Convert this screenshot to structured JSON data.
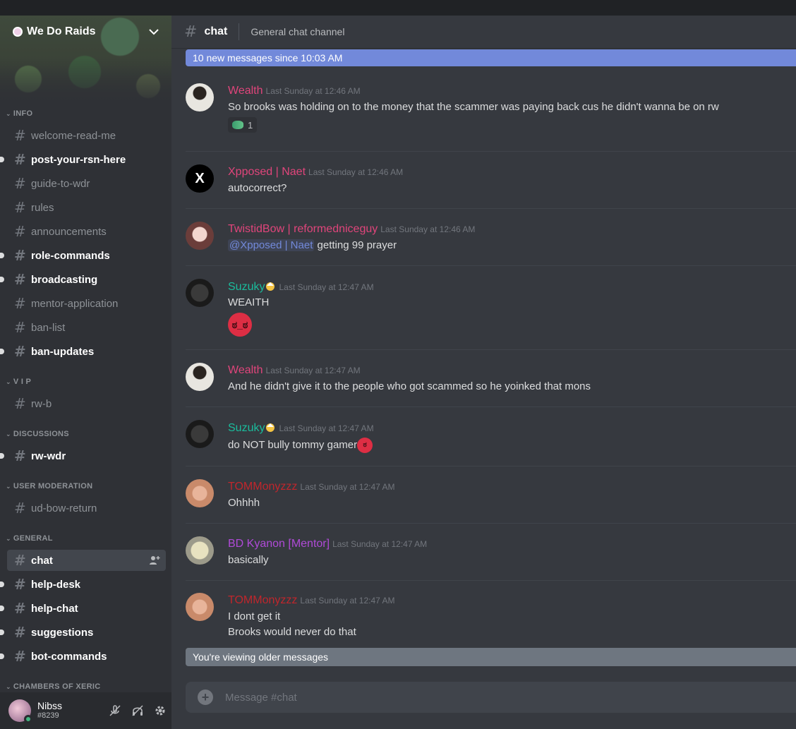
{
  "guild": {
    "name": "We Do Raids",
    "dropdown_icon": "chevron-down-icon"
  },
  "categories": [
    {
      "label": "INFO"
    },
    {
      "label": "V I P"
    },
    {
      "label": "DISCUSSIONS"
    },
    {
      "label": "USER MODERATION"
    },
    {
      "label": "GENERAL"
    },
    {
      "label": "CHAMBERS OF XERIC"
    }
  ],
  "channels": [
    {
      "label": "welcome-read-me"
    },
    {
      "label": "post-your-rsn-here"
    },
    {
      "label": "guide-to-wdr"
    },
    {
      "label": "rules"
    },
    {
      "label": "announcements"
    },
    {
      "label": "role-commands"
    },
    {
      "label": "broadcasting"
    },
    {
      "label": "mentor-application"
    },
    {
      "label": "ban-list"
    },
    {
      "label": "ban-updates"
    },
    {
      "label": "rw-b"
    },
    {
      "label": "rw-wdr"
    },
    {
      "label": "ud-bow-return"
    },
    {
      "label": "chat"
    },
    {
      "label": "help-desk"
    },
    {
      "label": "help-chat"
    },
    {
      "label": "suggestions"
    },
    {
      "label": "bot-commands"
    }
  ],
  "user": {
    "name": "Nibss",
    "tag": "#8239"
  },
  "header": {
    "channel": "chat",
    "topic": "General chat channel"
  },
  "new_messages_bar": "10 new messages since 10:03 AM",
  "older_messages_bar": "You're viewing older messages",
  "composer": {
    "placeholder": "Message #chat"
  },
  "messages": [
    {
      "author": "Wealth",
      "timestamp": "Last Sunday at 12:46 AM",
      "lines": [
        "So brooks was holding on to the money that the scammer was paying back cus he didn't wanna be on rw"
      ],
      "reaction_count": "1"
    },
    {
      "author": "Xpposed | Naet",
      "timestamp": "Last Sunday at 12:46 AM",
      "lines": [
        "autocorrect?"
      ]
    },
    {
      "author": "TwistidBow | reformedniceguy",
      "timestamp": "Last Sunday at 12:46 AM",
      "mention": "@Xpposed | Naet",
      "lines": [
        "getting 99 prayer"
      ]
    },
    {
      "author": "Suzuky",
      "timestamp": "Last Sunday at 12:47 AM",
      "lines": [
        "WEAITH"
      ]
    },
    {
      "author": "Wealth",
      "timestamp": "Last Sunday at 12:47 AM",
      "lines": [
        "And he didn't give it to the people who got scammed so he yoinked that mons"
      ]
    },
    {
      "author": "Suzuky",
      "timestamp": "Last Sunday at 12:47 AM",
      "lines": [
        "do NOT bully tommy gamer"
      ]
    },
    {
      "author": "TOMMonyzzz",
      "timestamp": "Last Sunday at 12:47 AM",
      "lines": [
        "Ohhhh"
      ]
    },
    {
      "author": "BD Kyanon [Mentor]",
      "timestamp": "Last Sunday at 12:47 AM",
      "lines": [
        "basically"
      ]
    },
    {
      "author": "TOMMonyzzz",
      "timestamp": "Last Sunday at 12:47 AM",
      "lines": [
        "I dont get it",
        "Brooks would never do that"
      ]
    }
  ],
  "colors": {
    "wealth": "#e0457b",
    "xpposed": "#e0457b",
    "twistid": "#e0457b",
    "suzuky": "#1abc9c",
    "tommonyzzz": "#c0262c",
    "kyanon": "#b04ad8",
    "accent": "#7289da"
  }
}
